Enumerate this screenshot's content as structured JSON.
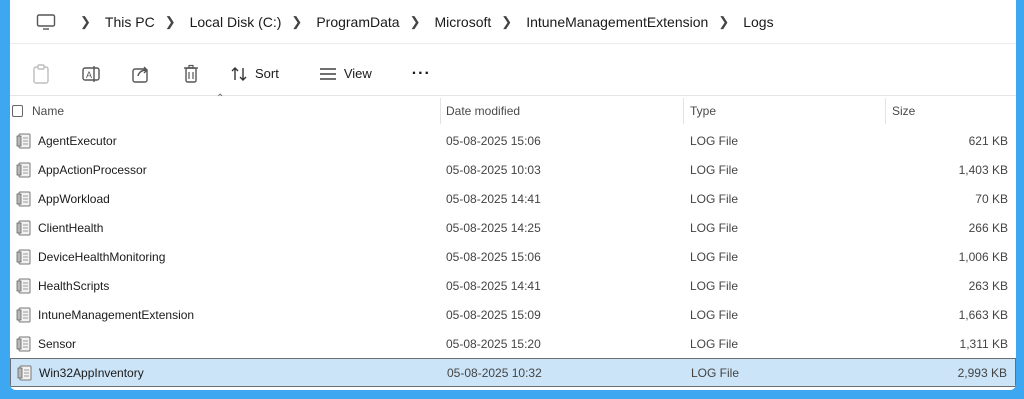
{
  "breadcrumb": [
    "This PC",
    "Local Disk (C:)",
    "ProgramData",
    "Microsoft",
    "IntuneManagementExtension",
    "Logs"
  ],
  "toolbar": {
    "sort_label": "Sort",
    "view_label": "View",
    "more_label": "···"
  },
  "columns": {
    "name": "Name",
    "date": "Date modified",
    "type": "Type",
    "size": "Size"
  },
  "files": [
    {
      "name": "AgentExecutor",
      "date": "05-08-2025 15:06",
      "type": "LOG File",
      "size": "621 KB"
    },
    {
      "name": "AppActionProcessor",
      "date": "05-08-2025 10:03",
      "type": "LOG File",
      "size": "1,403 KB"
    },
    {
      "name": "AppWorkload",
      "date": "05-08-2025 14:41",
      "type": "LOG File",
      "size": "70 KB"
    },
    {
      "name": "ClientHealth",
      "date": "05-08-2025 14:25",
      "type": "LOG File",
      "size": "266 KB"
    },
    {
      "name": "DeviceHealthMonitoring",
      "date": "05-08-2025 15:06",
      "type": "LOG File",
      "size": "1,006 KB"
    },
    {
      "name": "HealthScripts",
      "date": "05-08-2025 14:41",
      "type": "LOG File",
      "size": "263 KB"
    },
    {
      "name": "IntuneManagementExtension",
      "date": "05-08-2025 15:09",
      "type": "LOG File",
      "size": "1,663 KB"
    },
    {
      "name": "Sensor",
      "date": "05-08-2025 15:20",
      "type": "LOG File",
      "size": "1,311 KB"
    },
    {
      "name": "Win32AppInventory",
      "date": "05-08-2025 10:32",
      "type": "LOG File",
      "size": "2,993 KB",
      "selected": true
    }
  ],
  "colors": {
    "frame": "#3ea7f1",
    "selection": "#cce4f7"
  }
}
